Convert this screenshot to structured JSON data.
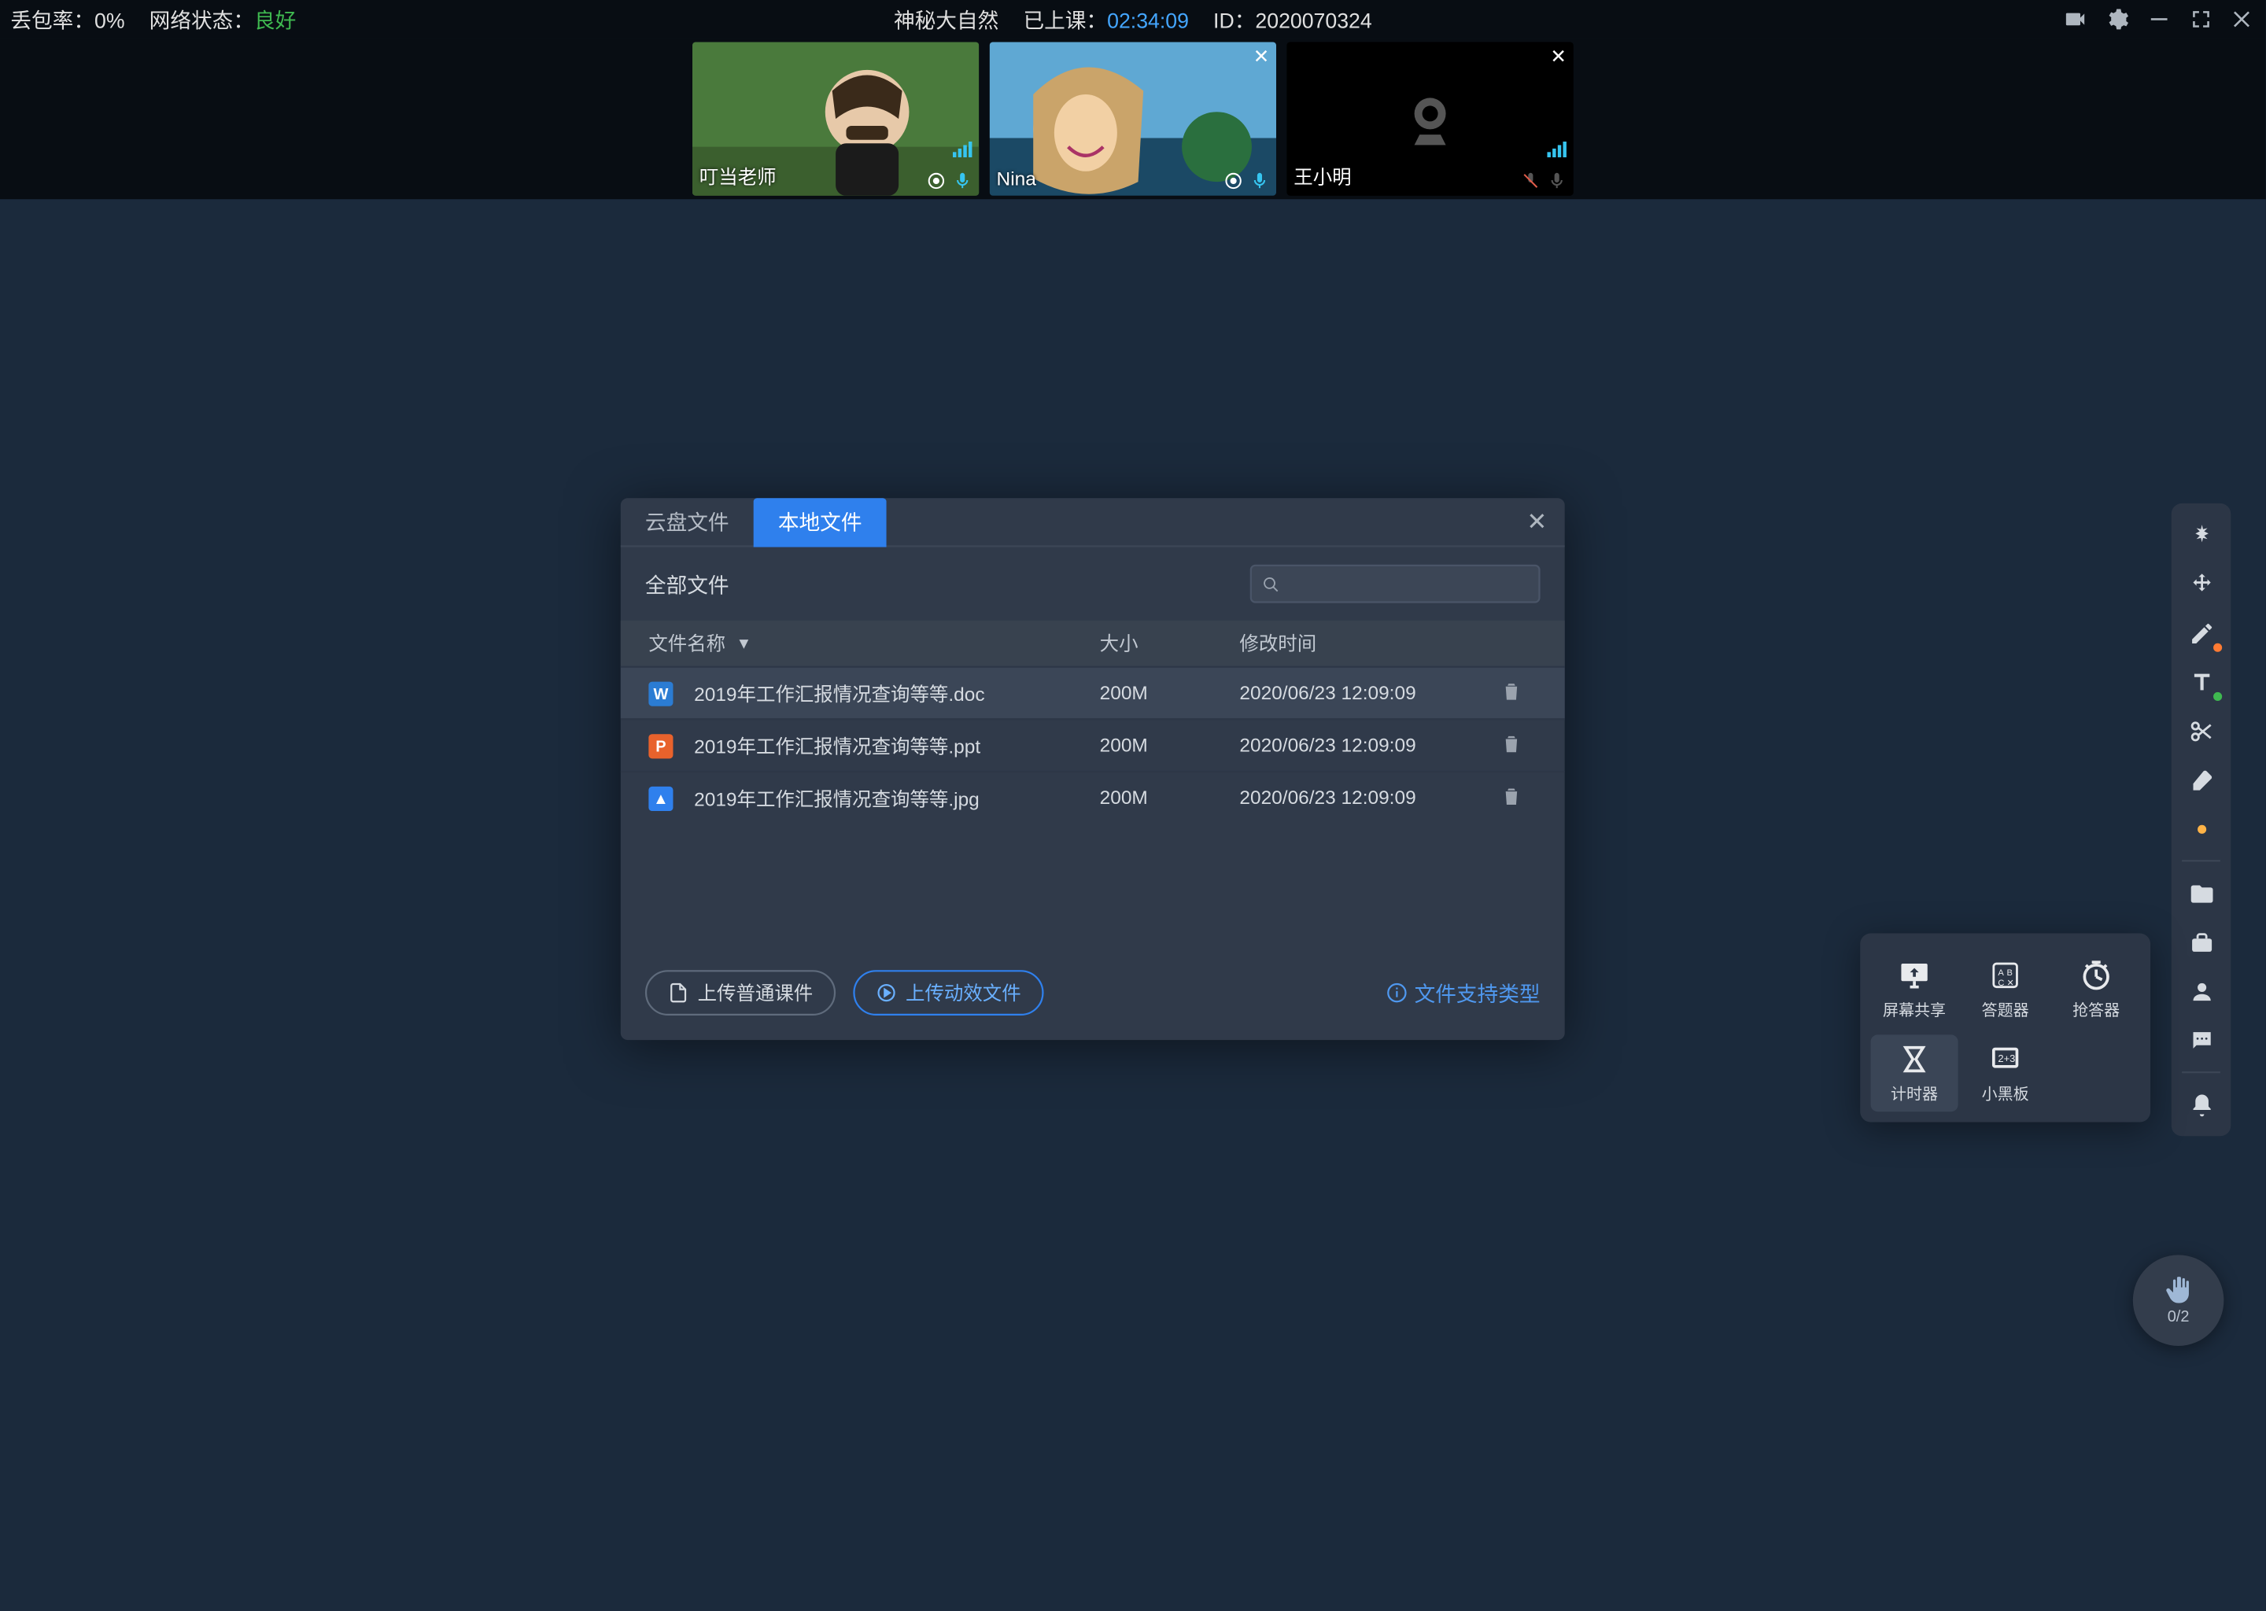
{
  "status": {
    "packet_loss_label": "丢包率：",
    "packet_loss": "0%",
    "net_label": "网络状态：",
    "net_state": "良好",
    "title": "神秘大自然",
    "elapsed_label": "已上课：",
    "elapsed": "02:34:09",
    "id_label": "ID：",
    "id": "2020070324"
  },
  "participants": [
    {
      "name": "叮当老师",
      "camera": true,
      "mic": true,
      "recording": true
    },
    {
      "name": "Nina",
      "camera": true,
      "mic": true,
      "recording": true
    },
    {
      "name": "王小明",
      "camera": false,
      "mic": true,
      "mic_muted_red": true
    }
  ],
  "dialog": {
    "tab_cloud": "云盘文件",
    "tab_local": "本地文件",
    "active_tab": "local",
    "filter_label": "全部文件",
    "search_placeholder": "",
    "col_name": "文件名称",
    "col_size": "大小",
    "col_date": "修改时间",
    "files": [
      {
        "icon": "w",
        "name": "2019年工作汇报情况查询等等.doc",
        "size": "200M",
        "date": "2020/06/23 12:09:09",
        "selected": true
      },
      {
        "icon": "p",
        "name": "2019年工作汇报情况查询等等.ppt",
        "size": "200M",
        "date": "2020/06/23 12:09:09",
        "selected": false
      },
      {
        "icon": "i",
        "name": "2019年工作汇报情况查询等等.jpg",
        "size": "200M",
        "date": "2020/06/23 12:09:09",
        "selected": false
      }
    ],
    "btn_upload_normal": "上传普通课件",
    "btn_upload_anim": "上传动效文件",
    "supported_types": "文件支持类型"
  },
  "tools_pop": {
    "screen_share": "屏幕共享",
    "answer": "答题器",
    "buzzer": "抢答器",
    "timer": "计时器",
    "blackboard": "小黑板"
  },
  "hand": {
    "count": "0/2"
  }
}
